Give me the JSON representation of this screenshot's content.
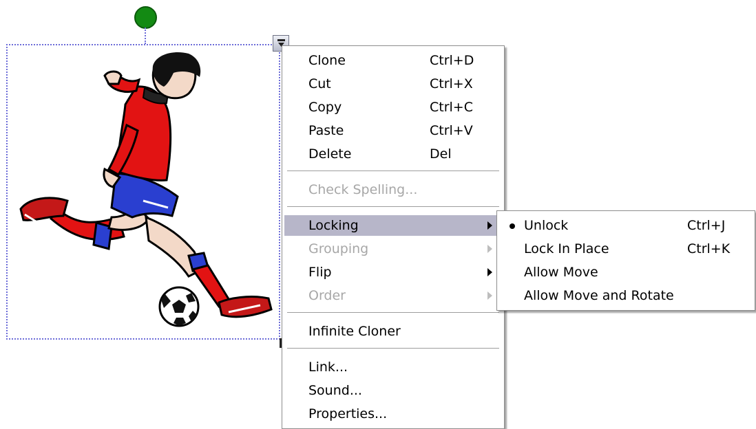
{
  "object": {
    "image_name": "soccer-player-clipart",
    "handle_colors": {
      "rotate": "#138a13",
      "selection": "#6b6bd8"
    }
  },
  "context_menu": {
    "items": [
      {
        "label": "Clone",
        "shortcut": "Ctrl+D",
        "enabled": true
      },
      {
        "label": "Cut",
        "shortcut": "Ctrl+X",
        "enabled": true
      },
      {
        "label": "Copy",
        "shortcut": "Ctrl+C",
        "enabled": true
      },
      {
        "label": "Paste",
        "shortcut": "Ctrl+V",
        "enabled": true
      },
      {
        "label": "Delete",
        "shortcut": "Del",
        "enabled": true
      },
      {
        "label": "Check Spelling...",
        "enabled": false
      },
      {
        "label": "Locking",
        "submenu": true,
        "enabled": true,
        "highlighted": true
      },
      {
        "label": "Grouping",
        "submenu": true,
        "enabled": false
      },
      {
        "label": "Flip",
        "submenu": true,
        "enabled": true
      },
      {
        "label": "Order",
        "submenu": true,
        "enabled": false
      },
      {
        "label": "Infinite Cloner",
        "enabled": true
      },
      {
        "label": "Link...",
        "enabled": true
      },
      {
        "label": "Sound...",
        "enabled": true
      },
      {
        "label": "Properties...",
        "enabled": true
      }
    ]
  },
  "locking_submenu": {
    "items": [
      {
        "label": "Unlock",
        "shortcut": "Ctrl+J",
        "selected": true
      },
      {
        "label": "Lock In Place",
        "shortcut": "Ctrl+K"
      },
      {
        "label": "Allow Move"
      },
      {
        "label": "Allow Move and Rotate"
      }
    ]
  },
  "colors": {
    "highlight": "#b7b6c9",
    "disabled_text": "#a7a7a7"
  }
}
